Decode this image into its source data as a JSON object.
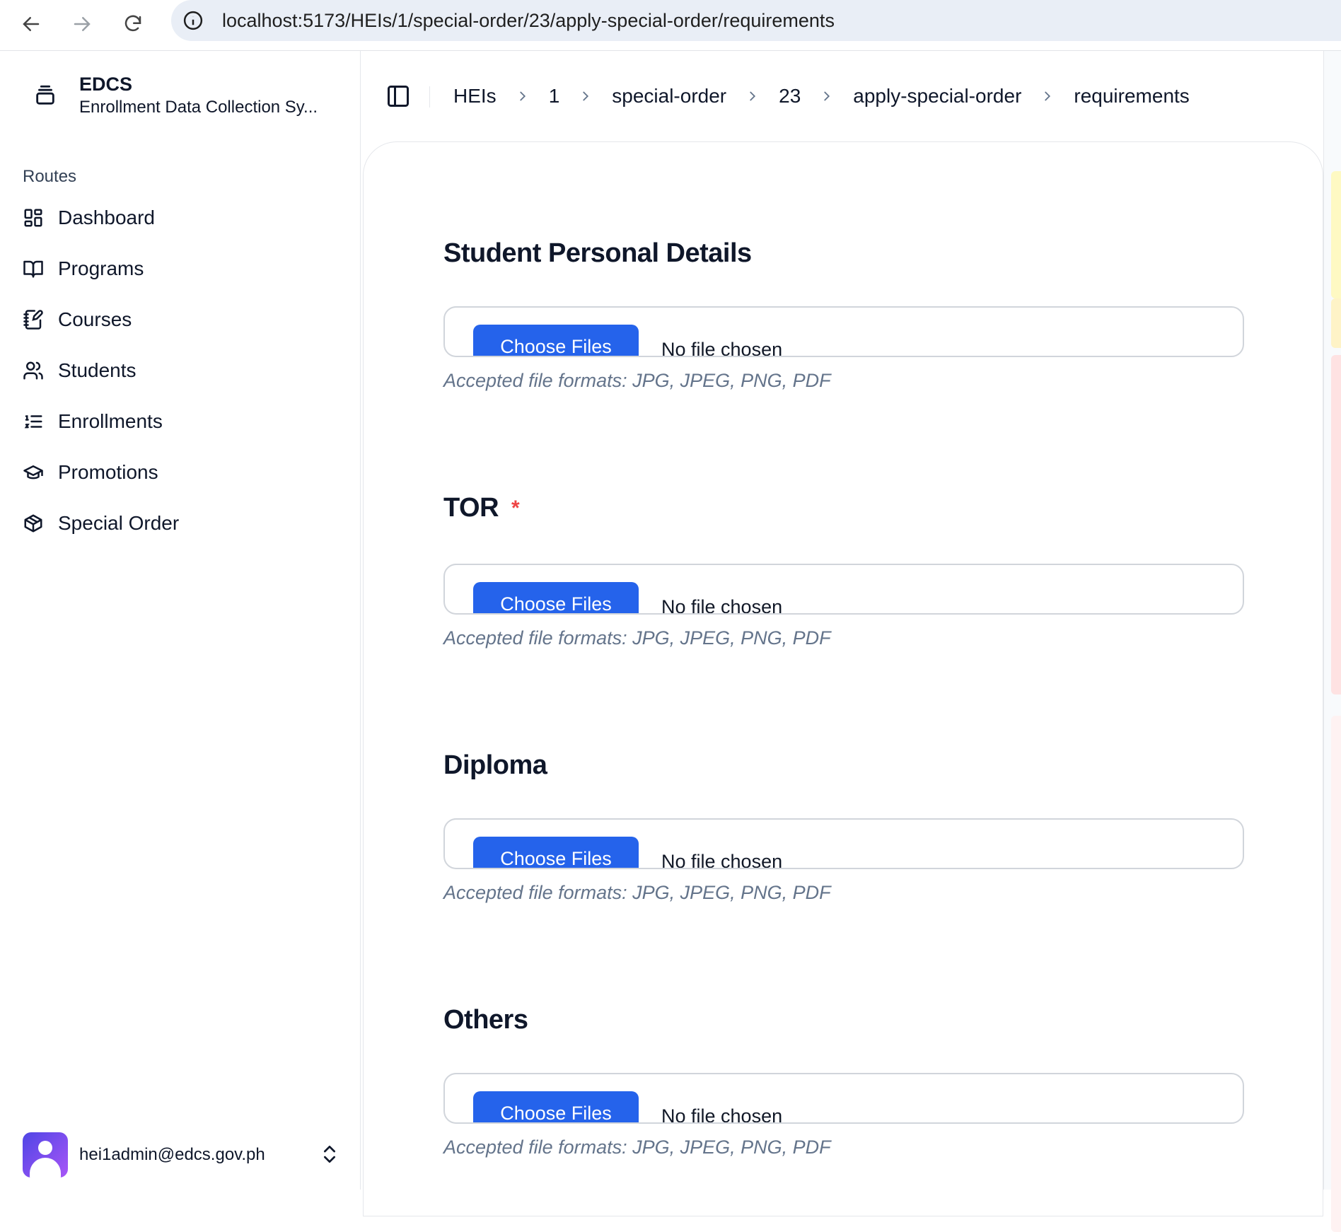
{
  "browser": {
    "url": "localhost:5173/HEIs/1/special-order/23/apply-special-order/requirements"
  },
  "brand": {
    "title": "EDCS",
    "subtitle": "Enrollment Data Collection Sy..."
  },
  "sidebar": {
    "group_label": "Routes",
    "items": [
      {
        "label": "Dashboard",
        "icon": "dashboard-icon"
      },
      {
        "label": "Programs",
        "icon": "book-open-icon"
      },
      {
        "label": "Courses",
        "icon": "notebook-pen-icon"
      },
      {
        "label": "Students",
        "icon": "users-icon"
      },
      {
        "label": "Enrollments",
        "icon": "list-ordered-icon"
      },
      {
        "label": "Promotions",
        "icon": "graduation-cap-icon"
      },
      {
        "label": "Special Order",
        "icon": "box-icon"
      }
    ],
    "user_email": "hei1admin@edcs.gov.ph"
  },
  "breadcrumb": [
    "HEIs",
    "1",
    "special-order",
    "23",
    "apply-special-order",
    "requirements"
  ],
  "sections": [
    {
      "title": "Student Personal Details",
      "required": false,
      "button": "Choose Files",
      "status": "No file chosen",
      "hint": "Accepted file formats: JPG, JPEG, PNG, PDF"
    },
    {
      "title": "TOR",
      "required": true,
      "required_mark": "*",
      "button": "Choose Files",
      "status": "No file chosen",
      "hint": "Accepted file formats: JPG, JPEG, PNG, PDF"
    },
    {
      "title": "Diploma",
      "required": false,
      "button": "Choose Files",
      "status": "No file chosen",
      "hint": "Accepted file formats: JPG, JPEG, PNG, PDF"
    },
    {
      "title": "Others",
      "required": false,
      "button": "Choose Files",
      "status": "No file chosen",
      "hint": "Accepted file formats: JPG, JPEG, PNG, PDF"
    }
  ],
  "colors": {
    "primary": "#2563eb",
    "required": "#ef4444",
    "hint": "#64748b"
  }
}
